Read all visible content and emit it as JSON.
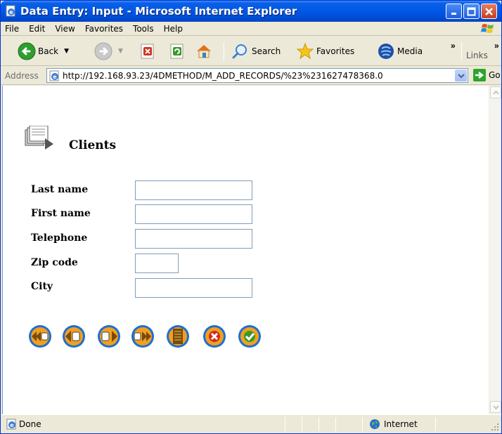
{
  "window": {
    "title": "Data Entry: Input - Microsoft Internet Explorer",
    "controls": [
      "minimize-icon",
      "maximize-icon",
      "close-icon"
    ]
  },
  "menu": {
    "items": [
      "File",
      "Edit",
      "View",
      "Favorites",
      "Tools",
      "Help"
    ]
  },
  "toolbar": {
    "back_label": "Back",
    "search_label": "Search",
    "favorites_label": "Favorites",
    "media_label": "Media",
    "links_label": "Links",
    "overflow_glyph": "»"
  },
  "address": {
    "label": "Address",
    "url": "http://192.168.93.23/4DMETHOD/M_ADD_RECORDS/%23%231627478368.0",
    "go_label": "Go"
  },
  "page": {
    "title": "Clients",
    "fields": [
      {
        "label": "Last name",
        "value": ""
      },
      {
        "label": "First name",
        "value": ""
      },
      {
        "label": "Telephone",
        "value": ""
      },
      {
        "label": "Zip code",
        "value": ""
      },
      {
        "label": "City",
        "value": ""
      }
    ],
    "nav_buttons": [
      "first-record-icon",
      "previous-record-icon",
      "next-record-icon",
      "last-record-icon",
      "list-records-icon",
      "cancel-icon",
      "validate-icon"
    ]
  },
  "status": {
    "text": "Done",
    "zone": "Internet"
  },
  "colors": {
    "titlebar": "#0058E6",
    "chrome": "#ECE9D8",
    "close_button": "#C4401F",
    "nav_orange": "#F0A020",
    "nav_blue": "#1E6FD0",
    "cancel_red": "#D22A1A",
    "validate_green": "#3A9A2A"
  }
}
